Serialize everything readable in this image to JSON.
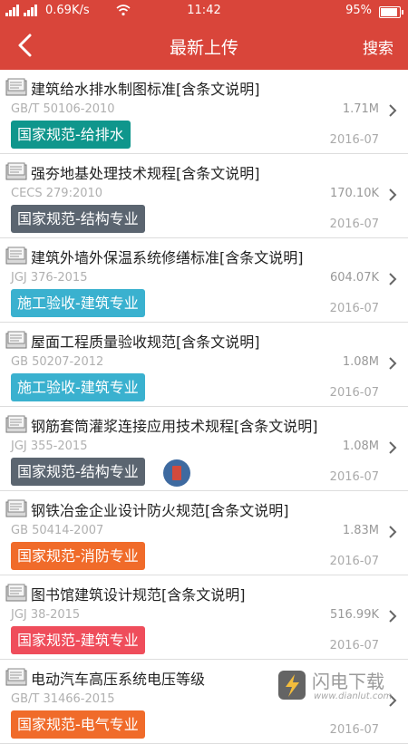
{
  "status_bar": {
    "network_speed": "0.69K/s",
    "time": "11:42",
    "battery": "95%"
  },
  "nav": {
    "title": "最新上传",
    "search_label": "搜索"
  },
  "items": [
    {
      "title": "建筑给水排水制图标准[含条文说明]",
      "code": "GB/T 50106-2010",
      "size": "1.71M",
      "category": "国家规范-给排水",
      "date": "2016-07"
    },
    {
      "title": "强夯地基处理技术规程[含条文说明]",
      "code": "CECS 279:2010",
      "size": "170.10K",
      "category": "国家规范-结构专业",
      "date": "2016-07"
    },
    {
      "title": "建筑外墙外保温系统修缮标准[含条文说明]",
      "code": "JGJ 376-2015",
      "size": "604.07K",
      "category": "施工验收-建筑专业",
      "date": "2016-07"
    },
    {
      "title": "屋面工程质量验收规范[含条文说明]",
      "code": "GB 50207-2012",
      "size": "1.08M",
      "category": "施工验收-建筑专业",
      "date": "2016-07"
    },
    {
      "title": "钢筋套筒灌浆连接应用技术规程[含条文说明]",
      "code": "JGJ 355-2015",
      "size": "1.08M",
      "category": "国家规范-结构专业",
      "date": "2016-07"
    },
    {
      "title": "钢铁冶金企业设计防火规范[含条文说明]",
      "code": "GB 50414-2007",
      "size": "1.83M",
      "category": "国家规范-消防专业",
      "date": "2016-07"
    },
    {
      "title": "图书馆建筑设计规范[含条文说明]",
      "code": "JGJ 38-2015",
      "size": "516.99K",
      "category": "国家规范-建筑专业",
      "date": "2016-07"
    },
    {
      "title": "电动汽车高压系统电压等级",
      "code": "GB/T 31466-2015",
      "size": "",
      "category": "国家规范-电气专业",
      "date": "2016-07"
    }
  ],
  "watermark": {
    "name": "闪电下载",
    "url": "www.dianlut.com"
  },
  "colors": {
    "accent": "#d9453a",
    "tag_teal": "#0f968c",
    "tag_slate": "#5b6570",
    "tag_cyan": "#3ab1cf",
    "tag_orange": "#f06b2a",
    "tag_pink": "#ef4d5b"
  }
}
